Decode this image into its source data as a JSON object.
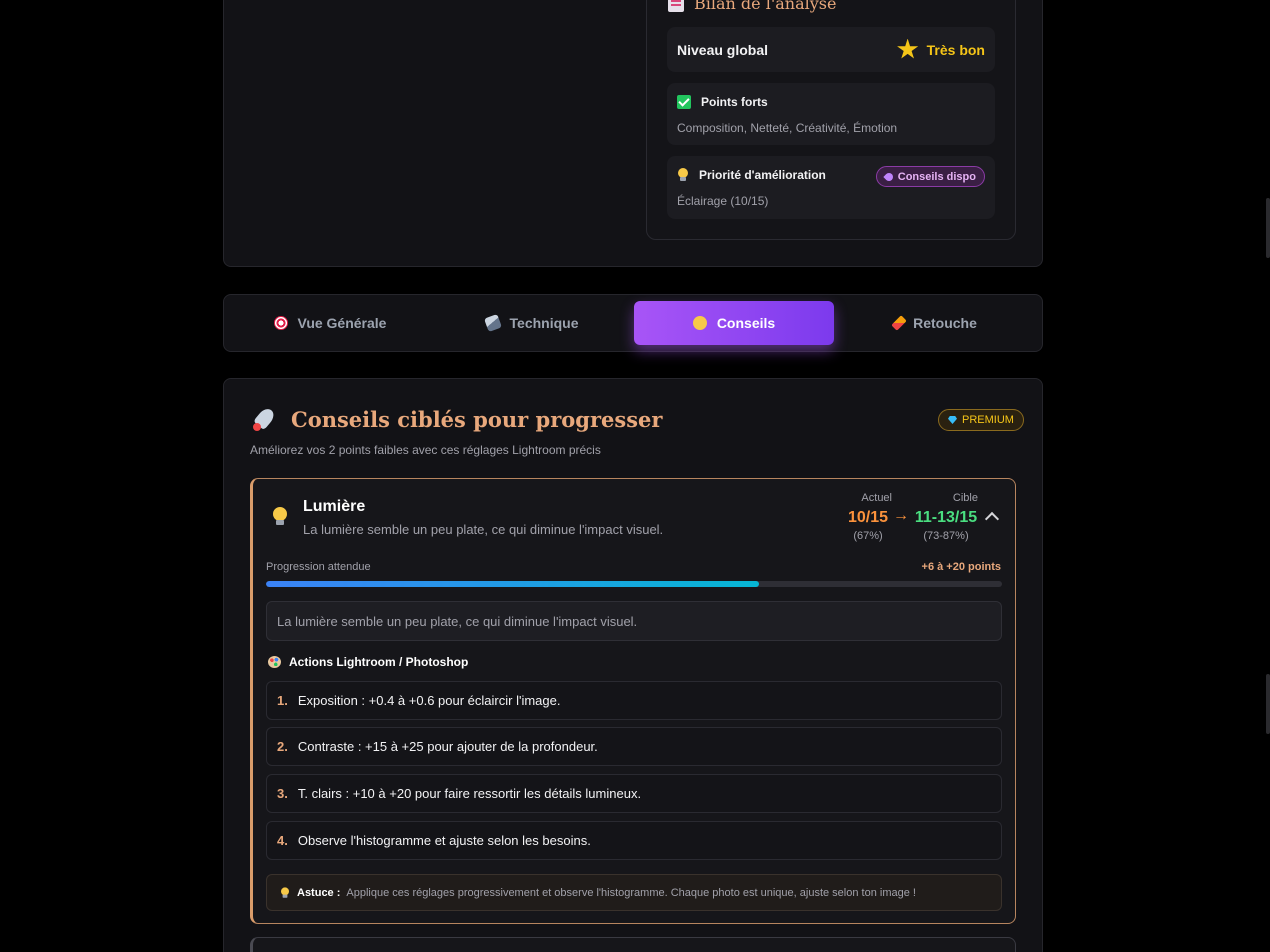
{
  "bilan": {
    "title": "Bilan de l'analyse",
    "niveau_label": "Niveau global",
    "niveau_value": "Très bon",
    "forts_label": "Points forts",
    "forts_value": "Composition, Netteté, Créativité, Émotion",
    "prio_label": "Priorité d'amélioration",
    "prio_badge": "Conseils dispo",
    "prio_value": "Éclairage (10/15)"
  },
  "tabs": [
    {
      "label": "Vue Générale",
      "icon": "target-icon"
    },
    {
      "label": "Technique",
      "icon": "microscope-icon"
    },
    {
      "label": "Conseils",
      "icon": "bulb-icon",
      "active": true
    },
    {
      "label": "Retouche",
      "icon": "brush-icon"
    }
  ],
  "conseils": {
    "title": "Conseils ciblés pour progresser",
    "subtitle": "Améliorez vos 2 points faibles avec ces réglages Lightroom précis",
    "badge": "PREMIUM"
  },
  "card": {
    "title": "Lumière",
    "description": "La lumière semble un peu plate, ce qui diminue l'impact visuel.",
    "actuel_label": "Actuel",
    "actuel_value": "10/15",
    "actuel_pct": "(67%)",
    "cible_label": "Cible",
    "cible_value": "11-13/15",
    "cible_pct": "(73-87%)",
    "arrow": "→",
    "progression_label": "Progression attendue",
    "progression_points": "+6 à +20 points",
    "progression_fraction": 0.67,
    "note": "La lumière semble un peu plate, ce qui diminue l'impact visuel.",
    "actions_title": "Actions Lightroom / Photoshop",
    "steps": [
      {
        "n": "1.",
        "text": "Exposition : +0.4 à +0.6 pour éclaircir l'image."
      },
      {
        "n": "2.",
        "text": "Contraste : +15 à +25 pour ajouter de la profondeur."
      },
      {
        "n": "3.",
        "text": "T. clairs : +10 à +20 pour faire ressortir les détails lumineux."
      },
      {
        "n": "4.",
        "text": "Observe l'histogramme et ajuste selon les besoins."
      }
    ],
    "tip_label": "Astuce :",
    "tip_text": "Applique ces réglages progressivement et observe l'histogramme. Chaque photo est unique, ajuste selon ton image !"
  },
  "colors": {
    "accent_purple": "#a855f7",
    "accent_orange": "#e8a87c",
    "current_score": "#fb923c",
    "target_score": "#4ade80",
    "gold": "#f5c518"
  }
}
